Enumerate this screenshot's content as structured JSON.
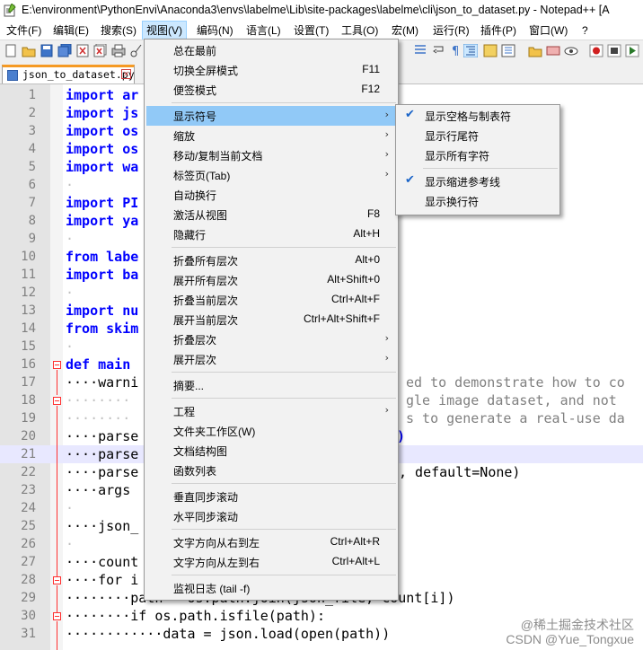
{
  "window": {
    "title": "E:\\environment\\PythonEnvi\\Anaconda3\\envs\\labelme\\Lib\\site-packages\\labelme\\cli\\json_to_dataset.py - Notepad++ [A"
  },
  "menubar": [
    {
      "label": "文件(F)"
    },
    {
      "label": "编辑(E)"
    },
    {
      "label": "搜索(S)"
    },
    {
      "label": "视图(V)"
    },
    {
      "label": "编码(N)"
    },
    {
      "label": "语言(L)"
    },
    {
      "label": "设置(T)"
    },
    {
      "label": "工具(O)"
    },
    {
      "label": "宏(M)"
    },
    {
      "label": "运行(R)"
    },
    {
      "label": "插件(P)"
    },
    {
      "label": "窗口(W)"
    },
    {
      "label": "?"
    }
  ],
  "tab": {
    "label": "json_to_dataset.py",
    "close": "×"
  },
  "editor": {
    "lines": [
      {
        "n": "1",
        "t": "import ar"
      },
      {
        "n": "2",
        "t": "import js"
      },
      {
        "n": "3",
        "t": "import os"
      },
      {
        "n": "4",
        "t": "import os"
      },
      {
        "n": "5",
        "t": "import wa"
      },
      {
        "n": "6",
        "t": "·"
      },
      {
        "n": "7",
        "t": "import PI"
      },
      {
        "n": "8",
        "t": "import ya"
      },
      {
        "n": "9",
        "t": "·"
      },
      {
        "n": "10",
        "t": "from labe"
      },
      {
        "n": "11",
        "t": "import ba"
      },
      {
        "n": "12",
        "t": "·"
      },
      {
        "n": "13",
        "t": "import nu"
      },
      {
        "n": "14",
        "t": "from skim"
      },
      {
        "n": "15",
        "t": "·"
      },
      {
        "n": "16",
        "t": "def main"
      },
      {
        "n": "17",
        "t": "····warni"
      },
      {
        "n": "18",
        "t": "········"
      },
      {
        "n": "19",
        "t": "········"
      },
      {
        "n": "20",
        "t": "····parse"
      },
      {
        "n": "21",
        "t": "····parse"
      },
      {
        "n": "22",
        "t": "····parse"
      },
      {
        "n": "23",
        "t": "····args"
      },
      {
        "n": "24",
        "t": "·"
      },
      {
        "n": "25",
        "t": "····json_"
      },
      {
        "n": "26",
        "t": "·"
      },
      {
        "n": "27",
        "t": "····count"
      },
      {
        "n": "28",
        "t": "····for i"
      },
      {
        "n": "29",
        "t": "········path = os.path.join(json_file, count[i])"
      },
      {
        "n": "30",
        "t": "········if os.path.isfile(path):"
      },
      {
        "n": "31",
        "t": "············data = json.load(open(path))"
      }
    ],
    "right_fragments": {
      "l17": "ed to demonstrate how to co",
      "l18": "gle image dataset, and not",
      "l19": "s to generate a real-use da",
      "l20": ")",
      "l22": ", default=None)"
    }
  },
  "view_menu": {
    "items": [
      {
        "label": "总在最前",
        "shortcut": ""
      },
      {
        "label": "切换全屏模式",
        "shortcut": "F11"
      },
      {
        "label": "便签模式",
        "shortcut": "F12"
      },
      {
        "label": "显示符号",
        "shortcut": "",
        "submenu": true
      },
      {
        "label": "缩放",
        "shortcut": "",
        "submenu": true
      },
      {
        "label": "移动/复制当前文档",
        "shortcut": "",
        "submenu": true
      },
      {
        "label": "标签页(Tab)",
        "shortcut": "",
        "submenu": true
      },
      {
        "label": "自动换行",
        "shortcut": ""
      },
      {
        "label": "激活从视图",
        "shortcut": "F8"
      },
      {
        "label": "隐藏行",
        "shortcut": "Alt+H"
      },
      {
        "label": "折叠所有层次",
        "shortcut": "Alt+0"
      },
      {
        "label": "展开所有层次",
        "shortcut": "Alt+Shift+0"
      },
      {
        "label": "折叠当前层次",
        "shortcut": "Ctrl+Alt+F"
      },
      {
        "label": "展开当前层次",
        "shortcut": "Ctrl+Alt+Shift+F"
      },
      {
        "label": "折叠层次",
        "shortcut": "",
        "submenu": true
      },
      {
        "label": "展开层次",
        "shortcut": "",
        "submenu": true
      },
      {
        "label": "摘要...",
        "shortcut": ""
      },
      {
        "label": "工程",
        "shortcut": "",
        "submenu": true
      },
      {
        "label": "文件夹工作区(W)",
        "shortcut": ""
      },
      {
        "label": "文档结构图",
        "shortcut": ""
      },
      {
        "label": "函数列表",
        "shortcut": ""
      },
      {
        "label": "垂直同步滚动",
        "shortcut": ""
      },
      {
        "label": "水平同步滚动",
        "shortcut": ""
      },
      {
        "label": "文字方向从右到左",
        "shortcut": "Ctrl+Alt+R"
      },
      {
        "label": "文字方向从左到右",
        "shortcut": "Ctrl+Alt+L"
      },
      {
        "label": "监视日志 (tail -f)",
        "shortcut": ""
      }
    ],
    "arrow": "›"
  },
  "symbols_submenu": {
    "items": [
      {
        "label": "显示空格与制表符",
        "checked": true
      },
      {
        "label": "显示行尾符",
        "checked": false
      },
      {
        "label": "显示所有字符",
        "checked": false
      },
      {
        "label": "显示缩进参考线",
        "checked": true
      },
      {
        "label": "显示换行符",
        "checked": false
      }
    ],
    "check": "✔"
  },
  "watermark": "@稀土掘金技术社区\nCSDN @Yue_Tongxue"
}
